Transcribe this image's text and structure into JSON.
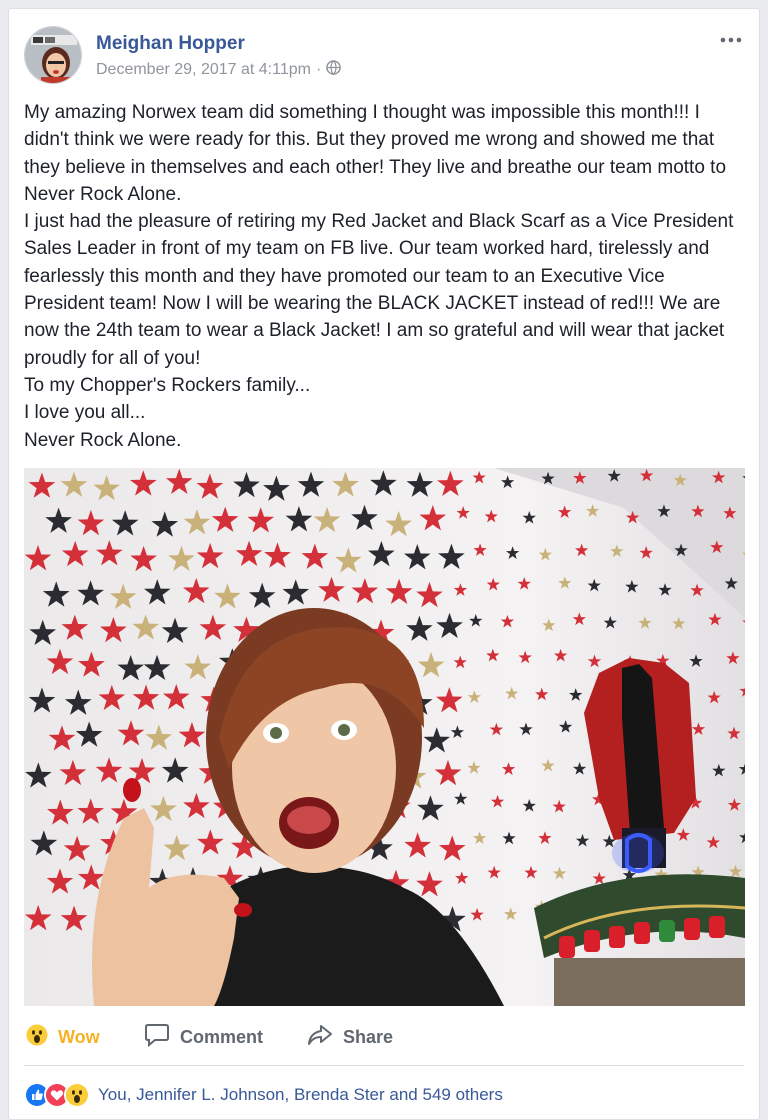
{
  "post": {
    "author": "Meighan Hopper",
    "timestamp": "December 29, 2017 at 4:11pm",
    "separator": "·",
    "privacy_icon": "globe-icon",
    "more_icon": "ellipsis-icon",
    "text_lines": [
      "My amazing Norwex team did something I thought was impossible this month!!! I didn't think we were ready for this. But they proved me wrong and showed me that they believe in themselves and each other! They live and breathe our team motto to Never Rock Alone.",
      "I just had the pleasure of retiring my Red Jacket and Black Scarf as a Vice President Sales Leader in front of my team on FB live. Our team worked hard, tirelessly and fearlessly this month and they have promoted our team to an Executive Vice President team! Now I will be wearing the BLACK JACKET instead of red!!! We are now the 24th team to wear a Black Jacket! I am so grateful and will wear that jacket proudly for all of you!",
      "To my Chopper's Rockers family...",
      "I love you all...",
      "Never Rock Alone."
    ]
  },
  "actions": {
    "wow_label": "Wow",
    "comment_label": "Comment",
    "share_label": "Share"
  },
  "reactions": {
    "icons": [
      "like-icon",
      "love-icon",
      "wow-icon"
    ],
    "summary": "You, Jennifer L. Johnson, Brenda Ster and 549 others"
  },
  "colors": {
    "link": "#385898",
    "wow": "#f7b125",
    "like": "#1877f2",
    "love": "#f33e58",
    "muted": "#90949c"
  }
}
